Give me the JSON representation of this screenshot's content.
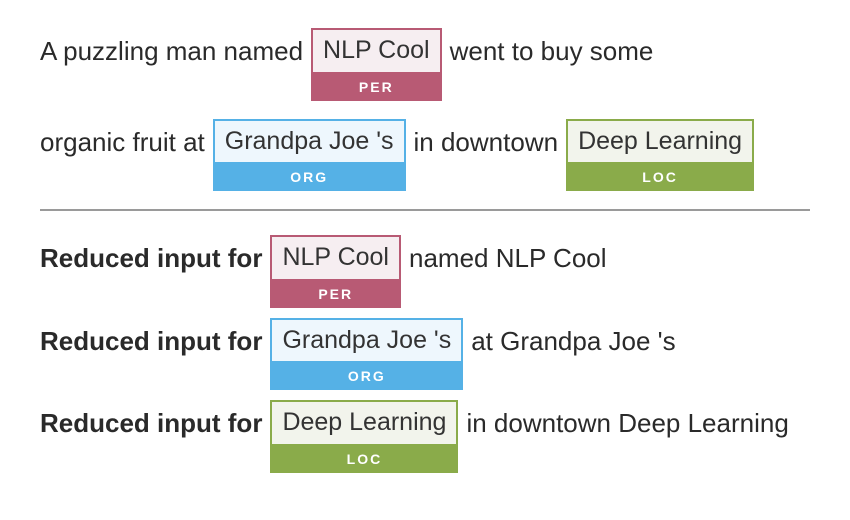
{
  "colors": {
    "per": "#b85a74",
    "org": "#55b1e6",
    "loc": "#8aab4a"
  },
  "sentence": {
    "pre1": "A puzzling man named",
    "ent1": {
      "text": "NLP Cool",
      "tag": "PER"
    },
    "mid1": "went to buy some",
    "pre2": "organic fruit at",
    "ent2": {
      "text": "Grandpa Joe 's",
      "tag": "ORG"
    },
    "mid2": "in downtown",
    "ent3": {
      "text": "Deep Learning",
      "tag": "LOC"
    }
  },
  "reduced": {
    "label": "Reduced input for",
    "rows": [
      {
        "entity": {
          "text": "NLP Cool",
          "tag": "PER"
        },
        "context": "named NLP Cool"
      },
      {
        "entity": {
          "text": "Grandpa Joe 's",
          "tag": "ORG"
        },
        "context": "at Grandpa Joe 's"
      },
      {
        "entity": {
          "text": "Deep Learning",
          "tag": "LOC"
        },
        "context": "in downtown Deep Learning"
      }
    ]
  }
}
